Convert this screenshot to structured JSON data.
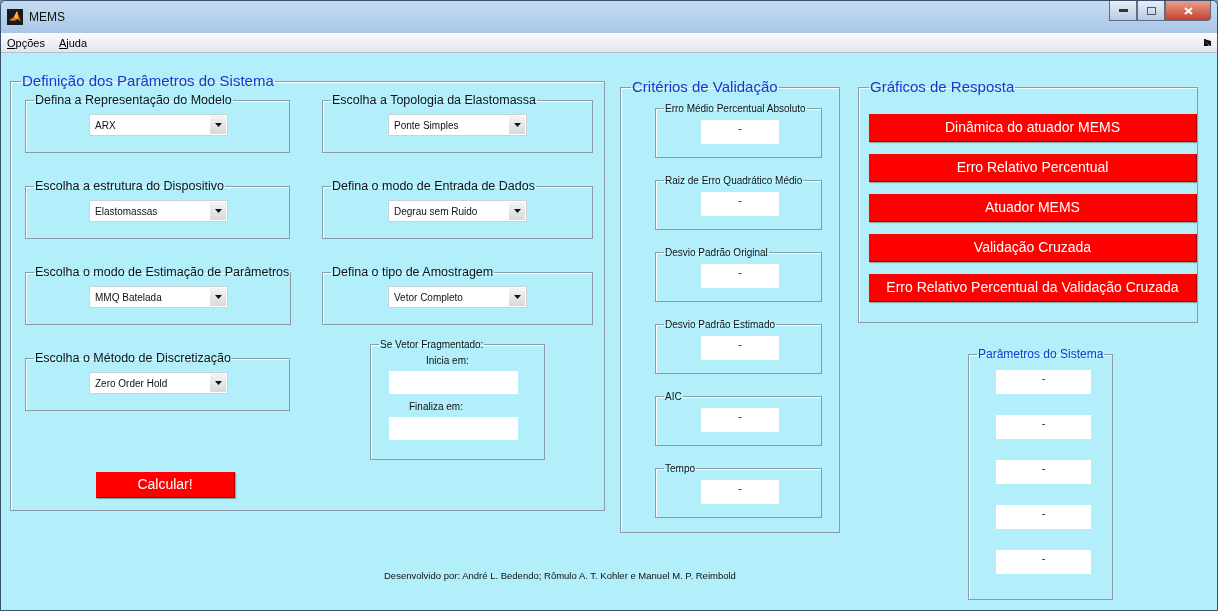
{
  "window": {
    "title": "MEMS"
  },
  "menu": [
    {
      "label": "Opções"
    },
    {
      "label": "Ajuda"
    }
  ],
  "system_definition": {
    "title": "Definição dos Parâmetros do Sistema",
    "groups": [
      {
        "title": "Defina a Representação do Modelo",
        "value": "ARX"
      },
      {
        "title": "Escolha a estrutura do Dispositivo",
        "value": "Elastomassas"
      },
      {
        "title": "Escolha o modo de Estimação de Parâmetros",
        "value": "MMQ Batelada"
      },
      {
        "title": "Escolha o Método de Discretização",
        "value": "Zero Order Hold"
      },
      {
        "title": "Escolha a Topologia da Elastomassa",
        "value": "Ponte Simples"
      },
      {
        "title": "Defina o modo de Entrada de Dados",
        "value": "Degrau sem Ruido"
      },
      {
        "title": "Defina o tipo de Amostragem",
        "value": "Vetor Completo"
      }
    ],
    "fragment": {
      "title": "Se Vetor Fragmentado:",
      "fields": [
        {
          "label": "Inicia em:"
        },
        {
          "label": "Finaliza em:"
        }
      ]
    },
    "calculate_button": "Calcular!"
  },
  "validation": {
    "title": "Critérios de Validação",
    "criteria": [
      {
        "label": "Erro Médio Percentual Absoluto",
        "value": "-"
      },
      {
        "label": "Raiz de Erro Quadrático Médio",
        "value": "-"
      },
      {
        "label": "Desvio Padrão Original",
        "value": "-"
      },
      {
        "label": "Desvio Padrão Estimado",
        "value": "-"
      },
      {
        "label": "AIC",
        "value": "-"
      },
      {
        "label": "Tempo",
        "value": "-"
      }
    ]
  },
  "response_graphs": {
    "title": "Gráficos de Resposta",
    "buttons": [
      "Dinâmica do atuador MEMS",
      "Erro Relativo Percentual",
      "Atuador MEMS",
      "Validação Cruzada",
      "Erro Relativo Percentual da Validação Cruzada"
    ]
  },
  "system_parameters": {
    "title": "Parâmetros do Sistema",
    "values": [
      "-",
      "-",
      "-",
      "-",
      "-"
    ]
  },
  "footer": "Desenvolvido por: André L. Bedendo; Rômulo A. T. Kohler e Manuel M. P. Reimbold"
}
